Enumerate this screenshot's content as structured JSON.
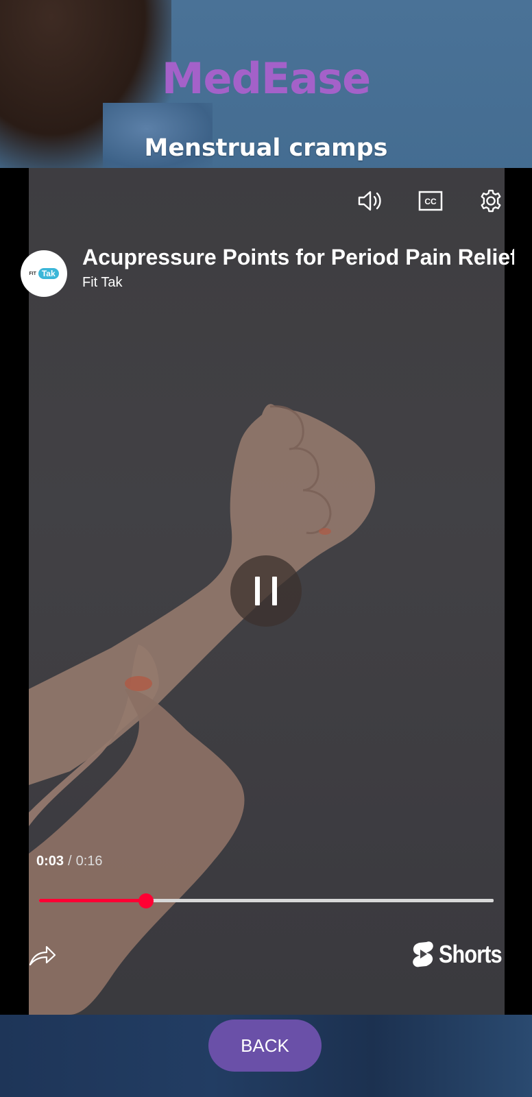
{
  "app": {
    "title": "MedEase",
    "subtitle": "Menstrual cramps"
  },
  "player": {
    "video_title": "Acupressure Points for Period Pain Relief",
    "channel_name": "Fit Tak",
    "channel_avatar": {
      "small_text": "FIT",
      "brand_text": "Tak"
    },
    "current_time": "0:03",
    "separator": "/",
    "duration": "0:16",
    "progress_fraction": 0.235,
    "icons": [
      "volume-icon",
      "closed-captions-icon",
      "settings-icon",
      "pause-icon",
      "share-icon",
      "shorts-logo-icon"
    ],
    "shorts_label": "Shorts",
    "colors": {
      "progress": "#ff0033",
      "track": "#d8d8d8"
    }
  },
  "footer": {
    "back_label": "BACK"
  },
  "colors": {
    "title_purple": "#a461c9",
    "button_purple": "#6a50a8"
  }
}
